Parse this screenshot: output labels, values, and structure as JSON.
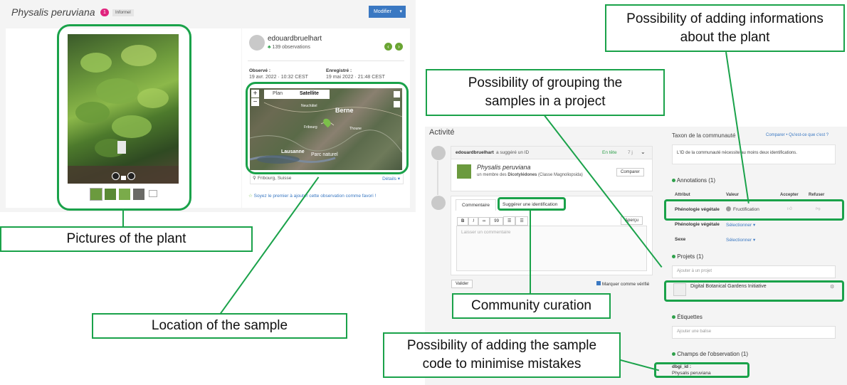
{
  "left": {
    "species_title": "Physalis peruviana",
    "badge_count": "1",
    "badge_tag": "Informel",
    "modify_button": "Modifier",
    "user_name": "edouardbruelhart",
    "user_obs": "139 observations",
    "observed_label": "Observé :",
    "observed_date": "19 avr. 2022 · 10:32 CEST",
    "recorded_label": "Enregistré :",
    "recorded_date": "19 mai 2022 · 21:48 CEST",
    "map_tab_plan": "Plan",
    "map_tab_satellite": "Satellite",
    "map_city_bern": "Berne",
    "map_city_lausanne": "Lausanne",
    "map_city_thun": "Thoune",
    "map_city_neuchatel": "Neuchâtel",
    "map_city_fribourg": "Fribourg",
    "map_region": "Parc naturel",
    "location": "Fribourg, Suisse",
    "details_link": "Détails ▾",
    "fav_text": "Soyez le premier à ajouter cette observation comme favori !"
  },
  "right": {
    "activity_title": "Activité",
    "suggest_user": "edouardbruelhart",
    "suggest_text": "a suggéré un ID",
    "suggest_status": "En tête",
    "suggest_age": "7 j",
    "taxon_name": "Physalis peruviana",
    "taxon_desc_pre": "un membre des ",
    "taxon_desc_bold": "Dicotylédones",
    "taxon_desc_post": " (Classe Magnoliopsida)",
    "compare_btn": "Comparer",
    "tab_comment": "Commentaire",
    "tab_suggest": "Suggérer une identification",
    "preview_btn": "Aperçu",
    "comment_placeholder": "Laisser un commentaire",
    "validate_btn": "Valider",
    "mark_verified": "Marquer comme vérifié",
    "community_title": "Taxon de la communauté",
    "compare_link": "Comparer",
    "what_link": "Qu'est-ce que c'est ?",
    "community_msg": "L'ID de la communauté nécessite au moins deux identifications.",
    "annotations_title": "Annotations (1)",
    "col_attr": "Attribut",
    "col_value": "Valeur",
    "col_accept": "Accepter",
    "col_refuse": "Refuser",
    "ann_rows": [
      {
        "attr": "Phénologie végétale",
        "value": "Fructification"
      },
      {
        "attr": "Phénologie végétale",
        "value": "Sélectionner ▾"
      },
      {
        "attr": "Sexe",
        "value": "Sélectionner ▾"
      }
    ],
    "projects_title": "Projets (1)",
    "project_placeholder": "Ajouter à un projet",
    "project_name": "Digital Botanical Gardens Initiative",
    "tags_title": "Étiquettes",
    "tag_placeholder": "Ajouter une balise",
    "fields_title": "Champs de l'observation (1)",
    "field_key": "dbgi_id :",
    "field_value": "Physalis peruviana"
  },
  "callouts": {
    "pictures": "Pictures of the plant",
    "location": "Location of the sample",
    "community": "Community curation",
    "code_line1": "Possibility of adding the sample",
    "code_line2": "code to minimise mistakes",
    "project_line1": "Possibility of grouping the",
    "project_line2": "samples in a project",
    "info_line1": "Possibility of adding informations",
    "info_line2": "about the plant"
  },
  "colors": {
    "accent": "#1aa24a",
    "brand_blue": "#3a78c2",
    "badge_pink": "#e0237d"
  }
}
